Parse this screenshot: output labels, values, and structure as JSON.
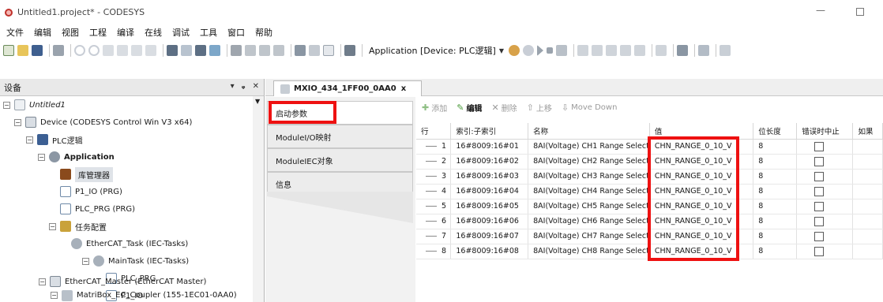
{
  "window": {
    "title": "Untitled1.project* - CODESYS",
    "minimize_glyph": "—"
  },
  "menu": [
    "文件",
    "编辑",
    "视图",
    "工程",
    "编译",
    "在线",
    "调试",
    "工具",
    "窗口",
    "帮助"
  ],
  "toolbar": {
    "active_application": "Application [Device: PLC逻辑]"
  },
  "devices_panel": {
    "title": "设备",
    "buttons": [
      "▾",
      "ᵩ",
      "✕"
    ],
    "tree": [
      {
        "label": "Untitled1",
        "icon": "project-icon",
        "style": "italic",
        "expander": "−"
      },
      {
        "label": "Device (CODESYS Control Win V3 x64)",
        "icon": "device-icon",
        "expander": "−"
      },
      {
        "label": "PLC逻辑",
        "icon": "plc-logic-icon",
        "expander": "−"
      },
      {
        "label": "Application",
        "icon": "application-icon",
        "style": "bold",
        "expander": "−"
      },
      {
        "label": "库管理器",
        "icon": "library-manager-icon"
      },
      {
        "label": "P1_IO (PRG)",
        "icon": "program-icon"
      },
      {
        "label": "PLC_PRG (PRG)",
        "icon": "program-icon"
      },
      {
        "label": "任务配置",
        "icon": "task-config-icon",
        "expander": "−"
      },
      {
        "label": "EtherCAT_Task (IEC-Tasks)",
        "icon": "task-icon"
      },
      {
        "label": "MainTask (IEC-Tasks)",
        "icon": "task-icon",
        "expander": "−"
      },
      {
        "label": "PLC_PRG",
        "icon": "program-call-icon"
      },
      {
        "label": "P1_IO",
        "icon": "program-call-icon"
      },
      {
        "label": "EtherCAT_Master (EtherCAT Master)",
        "icon": "ethercat-master-icon",
        "expander": "−"
      },
      {
        "label": "MatriBox_EC_Coupler (155-1EC01-0AA0)",
        "icon": "coupler-icon",
        "expander": "−"
      }
    ]
  },
  "editor": {
    "tab_label": "MXIO_434_1FF00_0AA0",
    "tab_close": "x",
    "side_tabs": [
      "启动参数",
      "ModuleI/O映射",
      "ModuleIEC对象",
      "信息"
    ],
    "actions": [
      {
        "label": "添加",
        "glyph": "✚",
        "enabled": false
      },
      {
        "label": "编辑",
        "glyph": "✎",
        "enabled": true
      },
      {
        "label": "删除",
        "glyph": "✕",
        "enabled": false
      },
      {
        "label": "上移",
        "glyph": "⇧",
        "enabled": false
      },
      {
        "label": "Move Down",
        "glyph": "⇩",
        "enabled": false
      }
    ],
    "columns": [
      "行",
      "索引:子索引",
      "名称",
      "值",
      "位长度",
      "错误时中止",
      "如果"
    ],
    "rows": [
      {
        "row": "1",
        "index": "16#8009:16#01",
        "name": "8AI(Voltage) CH1 Range Select",
        "value": "CHN_RANGE_0_10_V",
        "bits": "8",
        "abort": false
      },
      {
        "row": "2",
        "index": "16#8009:16#02",
        "name": "8AI(Voltage) CH2 Range Select",
        "value": "CHN_RANGE_0_10_V",
        "bits": "8",
        "abort": false
      },
      {
        "row": "3",
        "index": "16#8009:16#03",
        "name": "8AI(Voltage) CH3 Range Select",
        "value": "CHN_RANGE_0_10_V",
        "bits": "8",
        "abort": false
      },
      {
        "row": "4",
        "index": "16#8009:16#04",
        "name": "8AI(Voltage) CH4 Range Select",
        "value": "CHN_RANGE_0_10_V",
        "bits": "8",
        "abort": false
      },
      {
        "row": "5",
        "index": "16#8009:16#05",
        "name": "8AI(Voltage) CH5 Range Select",
        "value": "CHN_RANGE_0_10_V",
        "bits": "8",
        "abort": false
      },
      {
        "row": "6",
        "index": "16#8009:16#06",
        "name": "8AI(Voltage) CH6 Range Select",
        "value": "CHN_RANGE_0_10_V",
        "bits": "8",
        "abort": false
      },
      {
        "row": "7",
        "index": "16#8009:16#07",
        "name": "8AI(Voltage) CH7 Range Select",
        "value": "CHN_RANGE_0_10_V",
        "bits": "8",
        "abort": false
      },
      {
        "row": "8",
        "index": "16#8009:16#08",
        "name": "8AI(Voltage) CH8 Range Select",
        "value": "CHN_RANGE_0_10_V",
        "bits": "8",
        "abort": false
      }
    ]
  },
  "colors": {
    "highlight_red": "#ee1111",
    "accent_blue": "#2f6fb8",
    "enabled_green": "#4a9a3a"
  }
}
